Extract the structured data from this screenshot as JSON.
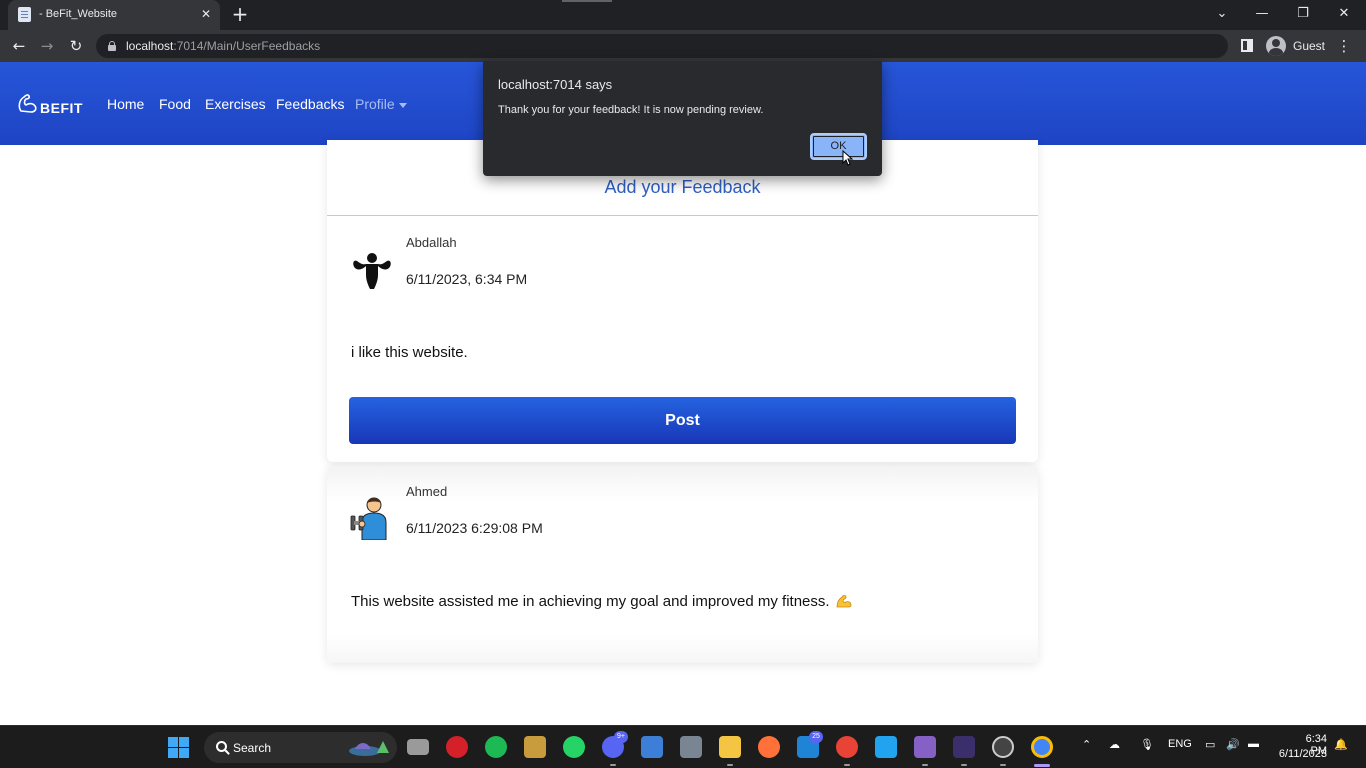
{
  "browser": {
    "tab_title": "- BeFit_Website",
    "url_host": "localhost",
    "url_path": ":7014/Main/UserFeedbacks",
    "profile_label": "Guest"
  },
  "navbar": {
    "brand": "BEFIT",
    "links": {
      "home": "Home",
      "food": "Food",
      "exercises": "Exercises",
      "feedbacks": "Feedbacks",
      "profile": "Profile"
    },
    "color": "#2450d2"
  },
  "add_feedback": {
    "title": "Add your Feedback",
    "user_name": "Abdallah",
    "date": "6/11/2023, 6:34 PM",
    "text": "i like this website.",
    "post_label": "Post",
    "avatar_icon": "bodybuilder-icon"
  },
  "feedbacks": [
    {
      "user_name": "Ahmed",
      "date": "6/11/2023 6:29:08 PM",
      "text": "This website assisted me in achieving my goal and improved my fitness.",
      "emoji": "flexed-biceps-icon",
      "avatar_icon": "man-lifting-dumbbell-icon"
    }
  ],
  "alert": {
    "title": "localhost:7014 says",
    "message": "Thank you for your feedback! It is now pending review.",
    "ok_label": "OK"
  },
  "taskbar": {
    "search_label": "Search",
    "discord_badge": "9+",
    "mail_badge": "25",
    "language": "ENG",
    "time": "6:34 PM",
    "date": "6/11/2023"
  }
}
